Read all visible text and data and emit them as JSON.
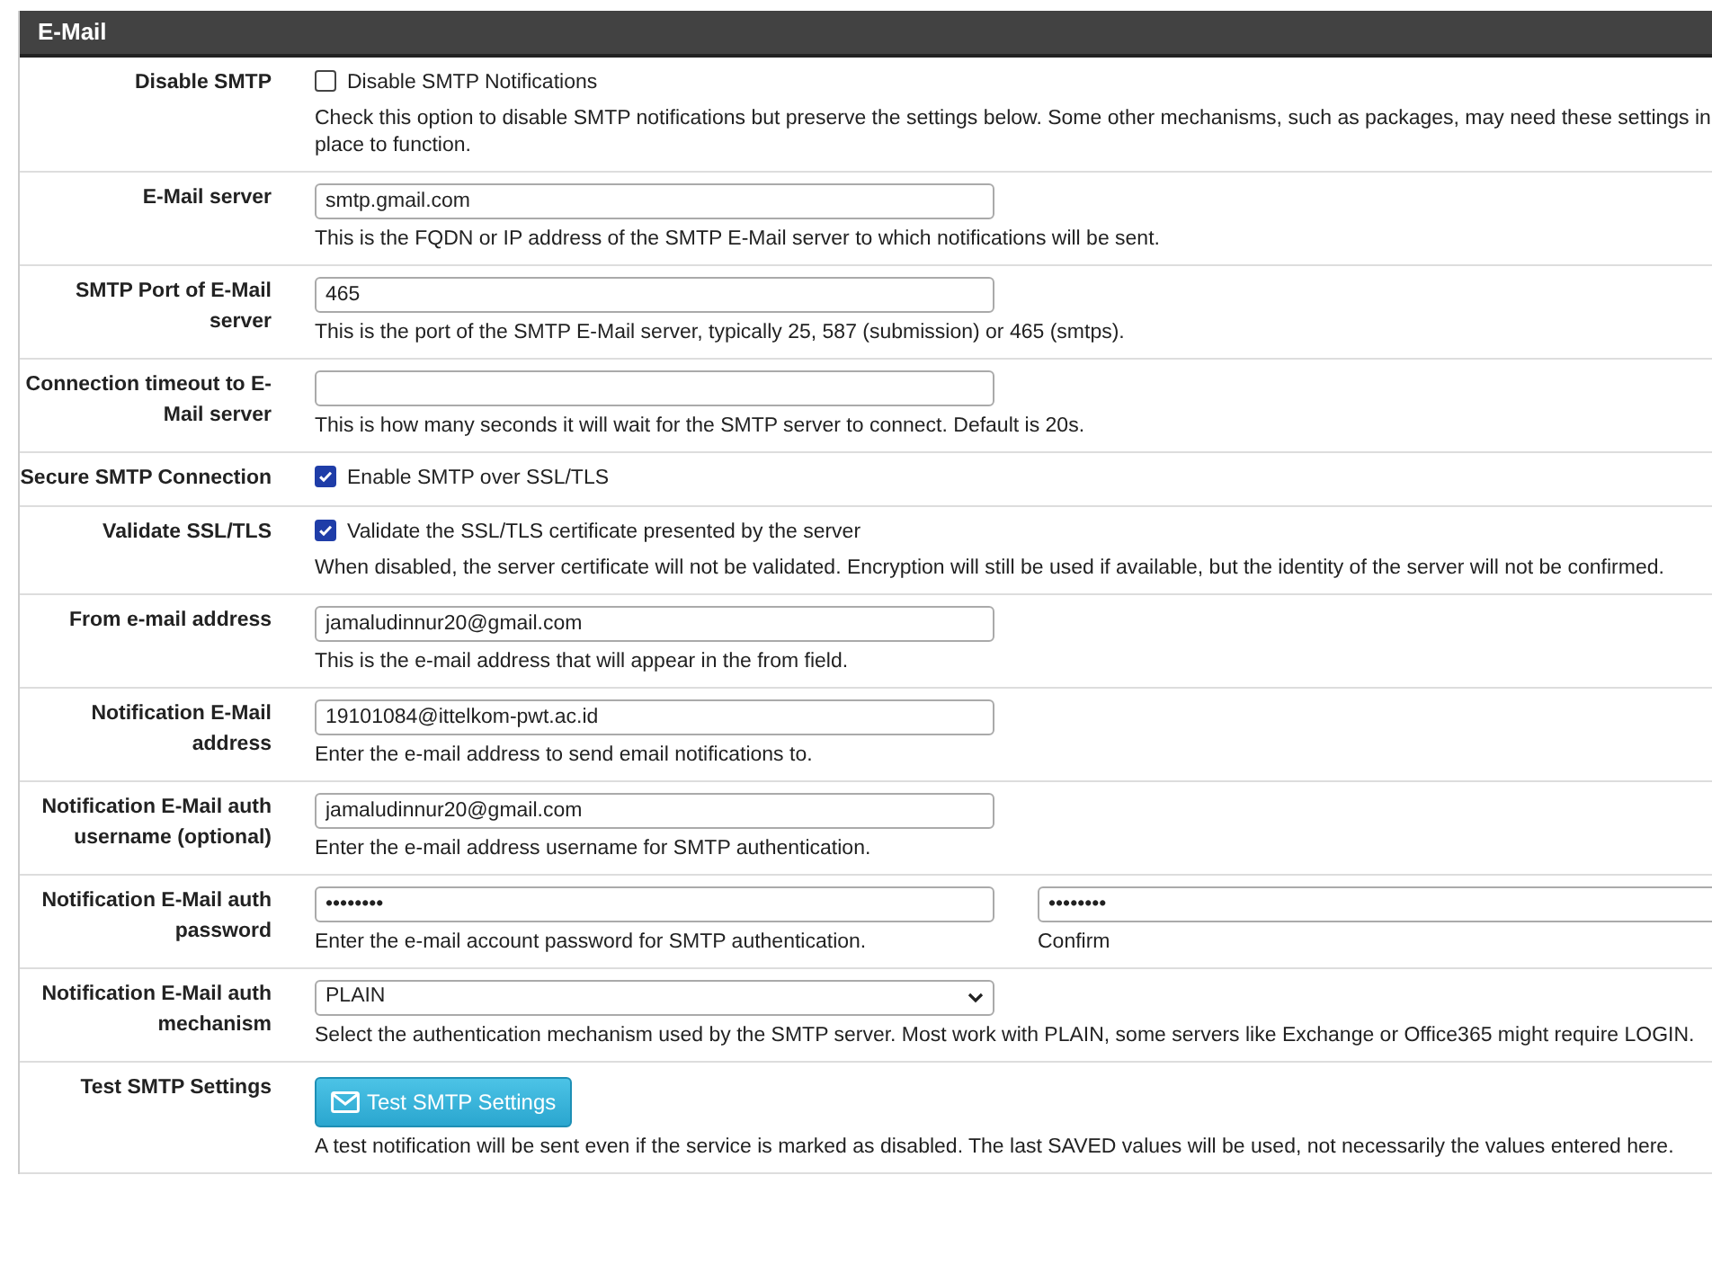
{
  "panel": {
    "title": "E-Mail"
  },
  "rows": [
    {
      "kind": "checkbox",
      "label": "Disable SMTP",
      "option": "Disable SMTP Notifications",
      "checked": false,
      "help": "Check this option to disable SMTP notifications but preserve the settings below. Some other mechanisms, such as packages, may need these settings in place to function."
    },
    {
      "kind": "text",
      "label": "E-Mail server",
      "value": "smtp.gmail.com",
      "help": "This is the FQDN or IP address of the SMTP E-Mail server to which notifications will be sent."
    },
    {
      "kind": "text",
      "label": "SMTP Port of E-Mail server",
      "value": "465",
      "help": "This is the port of the SMTP E-Mail server, typically 25, 587 (submission) or 465 (smtps)."
    },
    {
      "kind": "text",
      "label": "Connection timeout to E-Mail server",
      "help": "This is how many seconds it will wait for the SMTP server to connect. Default is 20s."
    },
    {
      "kind": "checkbox",
      "label": "Secure SMTP Connection",
      "option": "Enable SMTP over SSL/TLS",
      "checked": true
    },
    {
      "kind": "checkbox",
      "label": "Validate SSL/TLS",
      "option": "Validate the SSL/TLS certificate presented by the server",
      "checked": true,
      "help": "When disabled, the server certificate will not be validated. Encryption will still be used if available, but the identity of the server will not be confirmed."
    },
    {
      "kind": "text",
      "label": "From e-mail address",
      "value": "jamaludinnur20@gmail.com",
      "help": "This is the e-mail address that will appear in the from field."
    },
    {
      "kind": "text",
      "label": "Notification E-Mail address",
      "value": "19101084@ittelkom-pwt.ac.id",
      "help": "Enter the e-mail address to send email notifications to."
    },
    {
      "kind": "text",
      "label": "Notification E-Mail auth username (optional)",
      "value": "jamaludinnur20@gmail.com",
      "help": "Enter the e-mail address username for SMTP authentication."
    },
    {
      "kind": "password",
      "label": "Notification E-Mail auth password",
      "value": "••••••••",
      "help": "Enter the e-mail account password for SMTP authentication.",
      "confirm_value": "••••••••",
      "confirm_help": "Confirm"
    },
    {
      "kind": "select",
      "label": "Notification E-Mail auth mechanism",
      "value": "PLAIN",
      "help": "Select the authentication mechanism used by the SMTP server. Most work with PLAIN, some servers like Exchange or Office365 might require LOGIN."
    },
    {
      "kind": "button",
      "label": "Test SMTP Settings",
      "button": "Test SMTP Settings",
      "help": "A test notification will be sent even if the service is marked as disabled. The last SAVED values will be used, not necessarily the values entered here."
    }
  ]
}
